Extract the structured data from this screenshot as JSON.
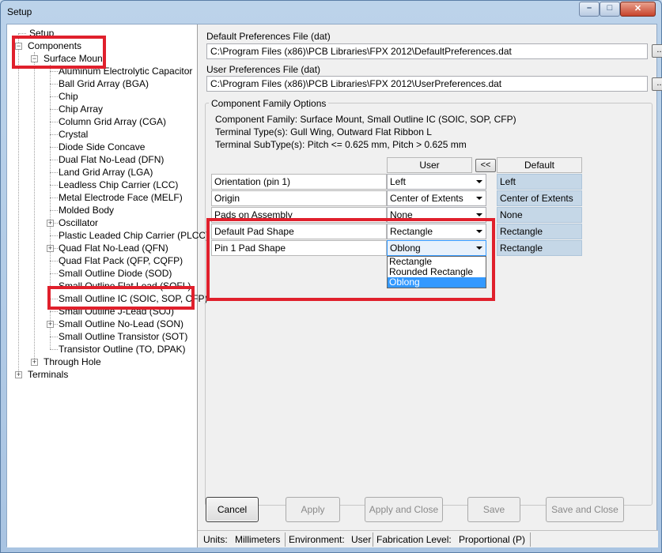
{
  "window": {
    "title": "Setup",
    "close_glyph": "✕",
    "min_glyph": "–",
    "max_glyph": "□"
  },
  "tree": {
    "setup": "Setup",
    "components": "Components",
    "surface_mount": "Surface Mount",
    "items": [
      "Aluminum Electrolytic Capacitor",
      "Ball Grid Array (BGA)",
      "Chip",
      "Chip Array",
      "Column Grid Array (CGA)",
      "Crystal",
      "Diode Side Concave",
      "Dual Flat No-Lead (DFN)",
      "Land Grid Array (LGA)",
      "Leadless Chip Carrier (LCC)",
      "Metal Electrode Face (MELF)",
      "Molded Body",
      "Oscillator",
      "Plastic Leaded Chip Carrier (PLCC)",
      "Quad Flat No-Lead (QFN)",
      "Quad Flat Pack (QFP, CQFP)",
      "Small Outline Diode (SOD)",
      "Small Outline Flat Lead (SOFL)",
      "Small Outline IC (SOIC, SOP, CFP)",
      "Small Outline J-Lead (SOJ)",
      "Small Outline No-Lead (SON)",
      "Small Outline Transistor (SOT)",
      "Transistor Outline (TO, DPAK)"
    ],
    "through_hole": "Through Hole",
    "terminals": "Terminals",
    "expand_glyph": "+",
    "collapse_glyph": "−"
  },
  "prefs": {
    "default_label": "Default Preferences File  (dat)",
    "default_path": "C:\\Program Files (x86)\\PCB Libraries\\FPX 2012\\DefaultPreferences.dat",
    "user_label": "User Preferences File  (dat)",
    "user_path": "C:\\Program Files (x86)\\PCB Libraries\\FPX 2012\\UserPreferences.dat",
    "browse_label": "..."
  },
  "family": {
    "group_title": "Component Family Options",
    "line1": "Component Family: Surface Mount, Small Outline IC (SOIC, SOP, CFP)",
    "line2": "Terminal Type(s): Gull Wing, Outward Flat Ribbon L",
    "line3": "Terminal SubType(s): Pitch <= 0.625 mm, Pitch > 0.625 mm"
  },
  "grid": {
    "user_header": "User",
    "default_header": "Default",
    "shift_label": "<<",
    "rows": [
      {
        "label": "Orientation (pin 1)",
        "user": "Left",
        "default": "Left"
      },
      {
        "label": "Origin",
        "user": "Center of Extents",
        "default": "Center of Extents"
      },
      {
        "label": "Pads on Assembly",
        "user": "None",
        "default": "None"
      },
      {
        "label": "Default Pad Shape",
        "user": "Rectangle",
        "default": "Rectangle"
      },
      {
        "label": "Pin 1 Pad Shape",
        "user": "Oblong",
        "default": "Rectangle"
      }
    ],
    "dropdown_options": [
      "Rectangle",
      "Rounded Rectangle",
      "Oblong"
    ],
    "dropdown_selected": "Oblong"
  },
  "buttons": {
    "cancel": "Cancel",
    "apply": "Apply",
    "apply_close": "Apply and Close",
    "save": "Save",
    "save_close": "Save and Close"
  },
  "status": {
    "units_label": "Units:",
    "units_value": "Millimeters",
    "env_label": "Environment:",
    "env_value": "User",
    "fab_label": "Fabrication Level:",
    "fab_value": "Proportional (P)"
  },
  "colors": {
    "highlight": "#e0202c",
    "selection": "#3399ff",
    "default_cell": "#c5d7e7"
  }
}
